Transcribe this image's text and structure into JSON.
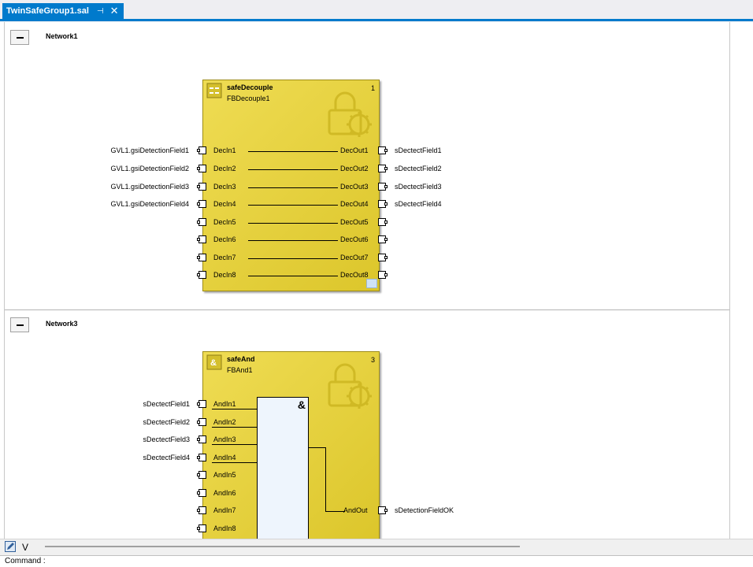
{
  "tab": {
    "title": "TwinSafeGroup1.sal",
    "pin_glyph": "⊣",
    "close_glyph": "✕"
  },
  "networks": [
    {
      "title": "Network1",
      "block": {
        "type": "safeDecouple",
        "instance": "FBDecouple1",
        "number": "1",
        "inputs": [
          "DecIn1",
          "DecIn2",
          "DecIn3",
          "DecIn4",
          "DecIn5",
          "DecIn6",
          "DecIn7",
          "DecIn8"
        ],
        "outputs": [
          "DecOut1",
          "DecOut2",
          "DecOut3",
          "DecOut4",
          "DecOut5",
          "DecOut6",
          "DecOut7",
          "DecOut8"
        ],
        "input_vars": [
          "GVL1.gsiDetectionField1",
          "GVL1.gsiDetectionField2",
          "GVL1.gsiDetectionField3",
          "GVL1.gsiDetectionField4"
        ],
        "output_vars": [
          "sDectectField1",
          "sDectectField2",
          "sDectectField3",
          "sDectectField4"
        ]
      }
    },
    {
      "title": "Network3",
      "block": {
        "type": "safeAnd",
        "instance": "FBAnd1",
        "number": "3",
        "and_symbol": "&",
        "inputs": [
          "AndIn1",
          "AndIn2",
          "AndIn3",
          "AndIn4",
          "AndIn5",
          "AndIn6",
          "AndIn7",
          "AndIn8"
        ],
        "output": "AndOut",
        "input_vars": [
          "sDectectField1",
          "sDectectField2",
          "sDectectField3",
          "sDectectField4"
        ],
        "output_var": "sDetectionFieldOK"
      }
    }
  ],
  "toolbar": {
    "icon": "edit-pencil-icon",
    "v_label": "V"
  },
  "command": {
    "label": "Command :"
  },
  "colors": {
    "accent": "#007acc",
    "block_fill": "#e2cd35",
    "and_box_fill": "#eef5fd"
  }
}
